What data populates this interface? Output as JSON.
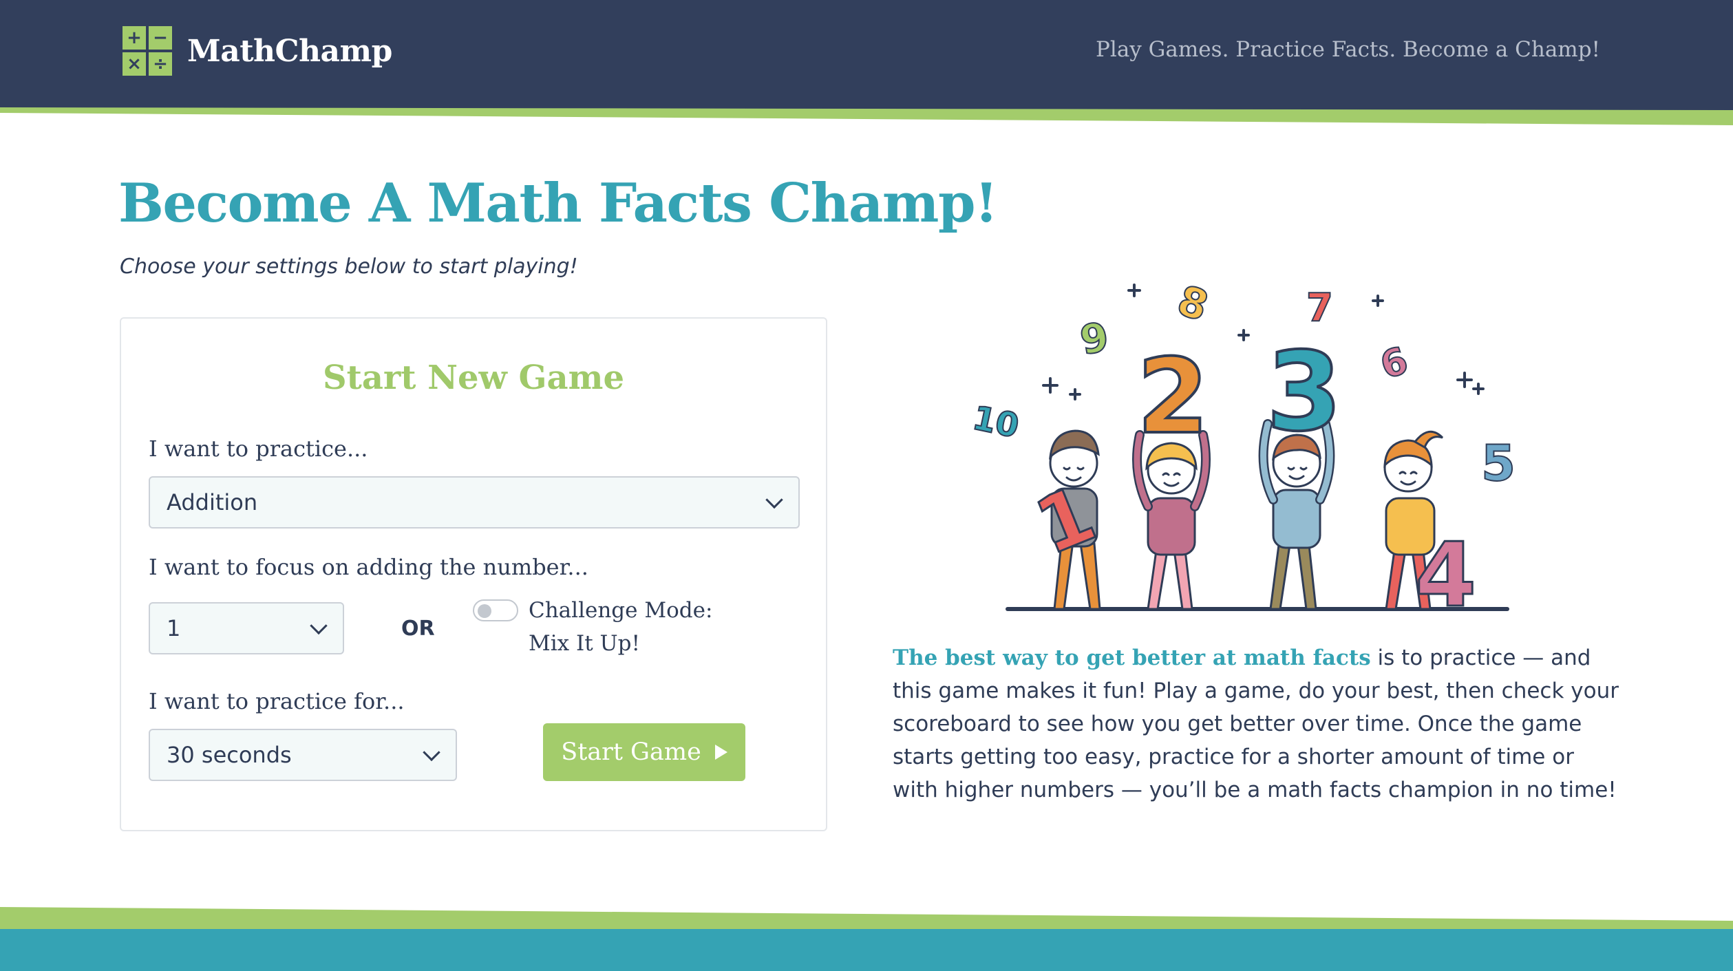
{
  "header": {
    "brand_name": "MathChamp",
    "logo_symbols": [
      "+",
      "−",
      "×",
      "÷"
    ],
    "tagline": "Play Games. Practice Facts. Become a Champ!"
  },
  "hero": {
    "title": "Become A Math Facts Champ!",
    "subtitle": "Choose your settings below to start playing!"
  },
  "game_form": {
    "title": "Start New Game",
    "practice_label": "I want to practice...",
    "practice_value": "Addition",
    "focus_label": "I want to focus on adding the number...",
    "focus_value": "1",
    "or_label": "OR",
    "challenge_line1": "Challenge Mode:",
    "challenge_line2": "Mix It Up!",
    "challenge_enabled": false,
    "duration_label": "I want to practice for...",
    "duration_value": "30 seconds",
    "start_button": "Start Game"
  },
  "description": {
    "lead": "The best way to get better at math facts",
    "body": " is to practice — and this game makes it fun! Play a game, do your best, then check your scoreboard to see how you get better over time. Once the game starts getting too easy, practice for a shorter amount of time or with higher numbers — you’ll be a math facts champion in no time!"
  },
  "illustration": {
    "numbers": [
      "10",
      "9",
      "8",
      "7",
      "6",
      "5",
      "2",
      "3",
      "1",
      "4"
    ]
  },
  "colors": {
    "navy": "#323f5c",
    "teal": "#35a3b4",
    "green": "#a3cc6b",
    "orange": "#e8913a",
    "pink": "#d37a9a",
    "yellow": "#f5bf4f",
    "red": "#e8625d"
  }
}
